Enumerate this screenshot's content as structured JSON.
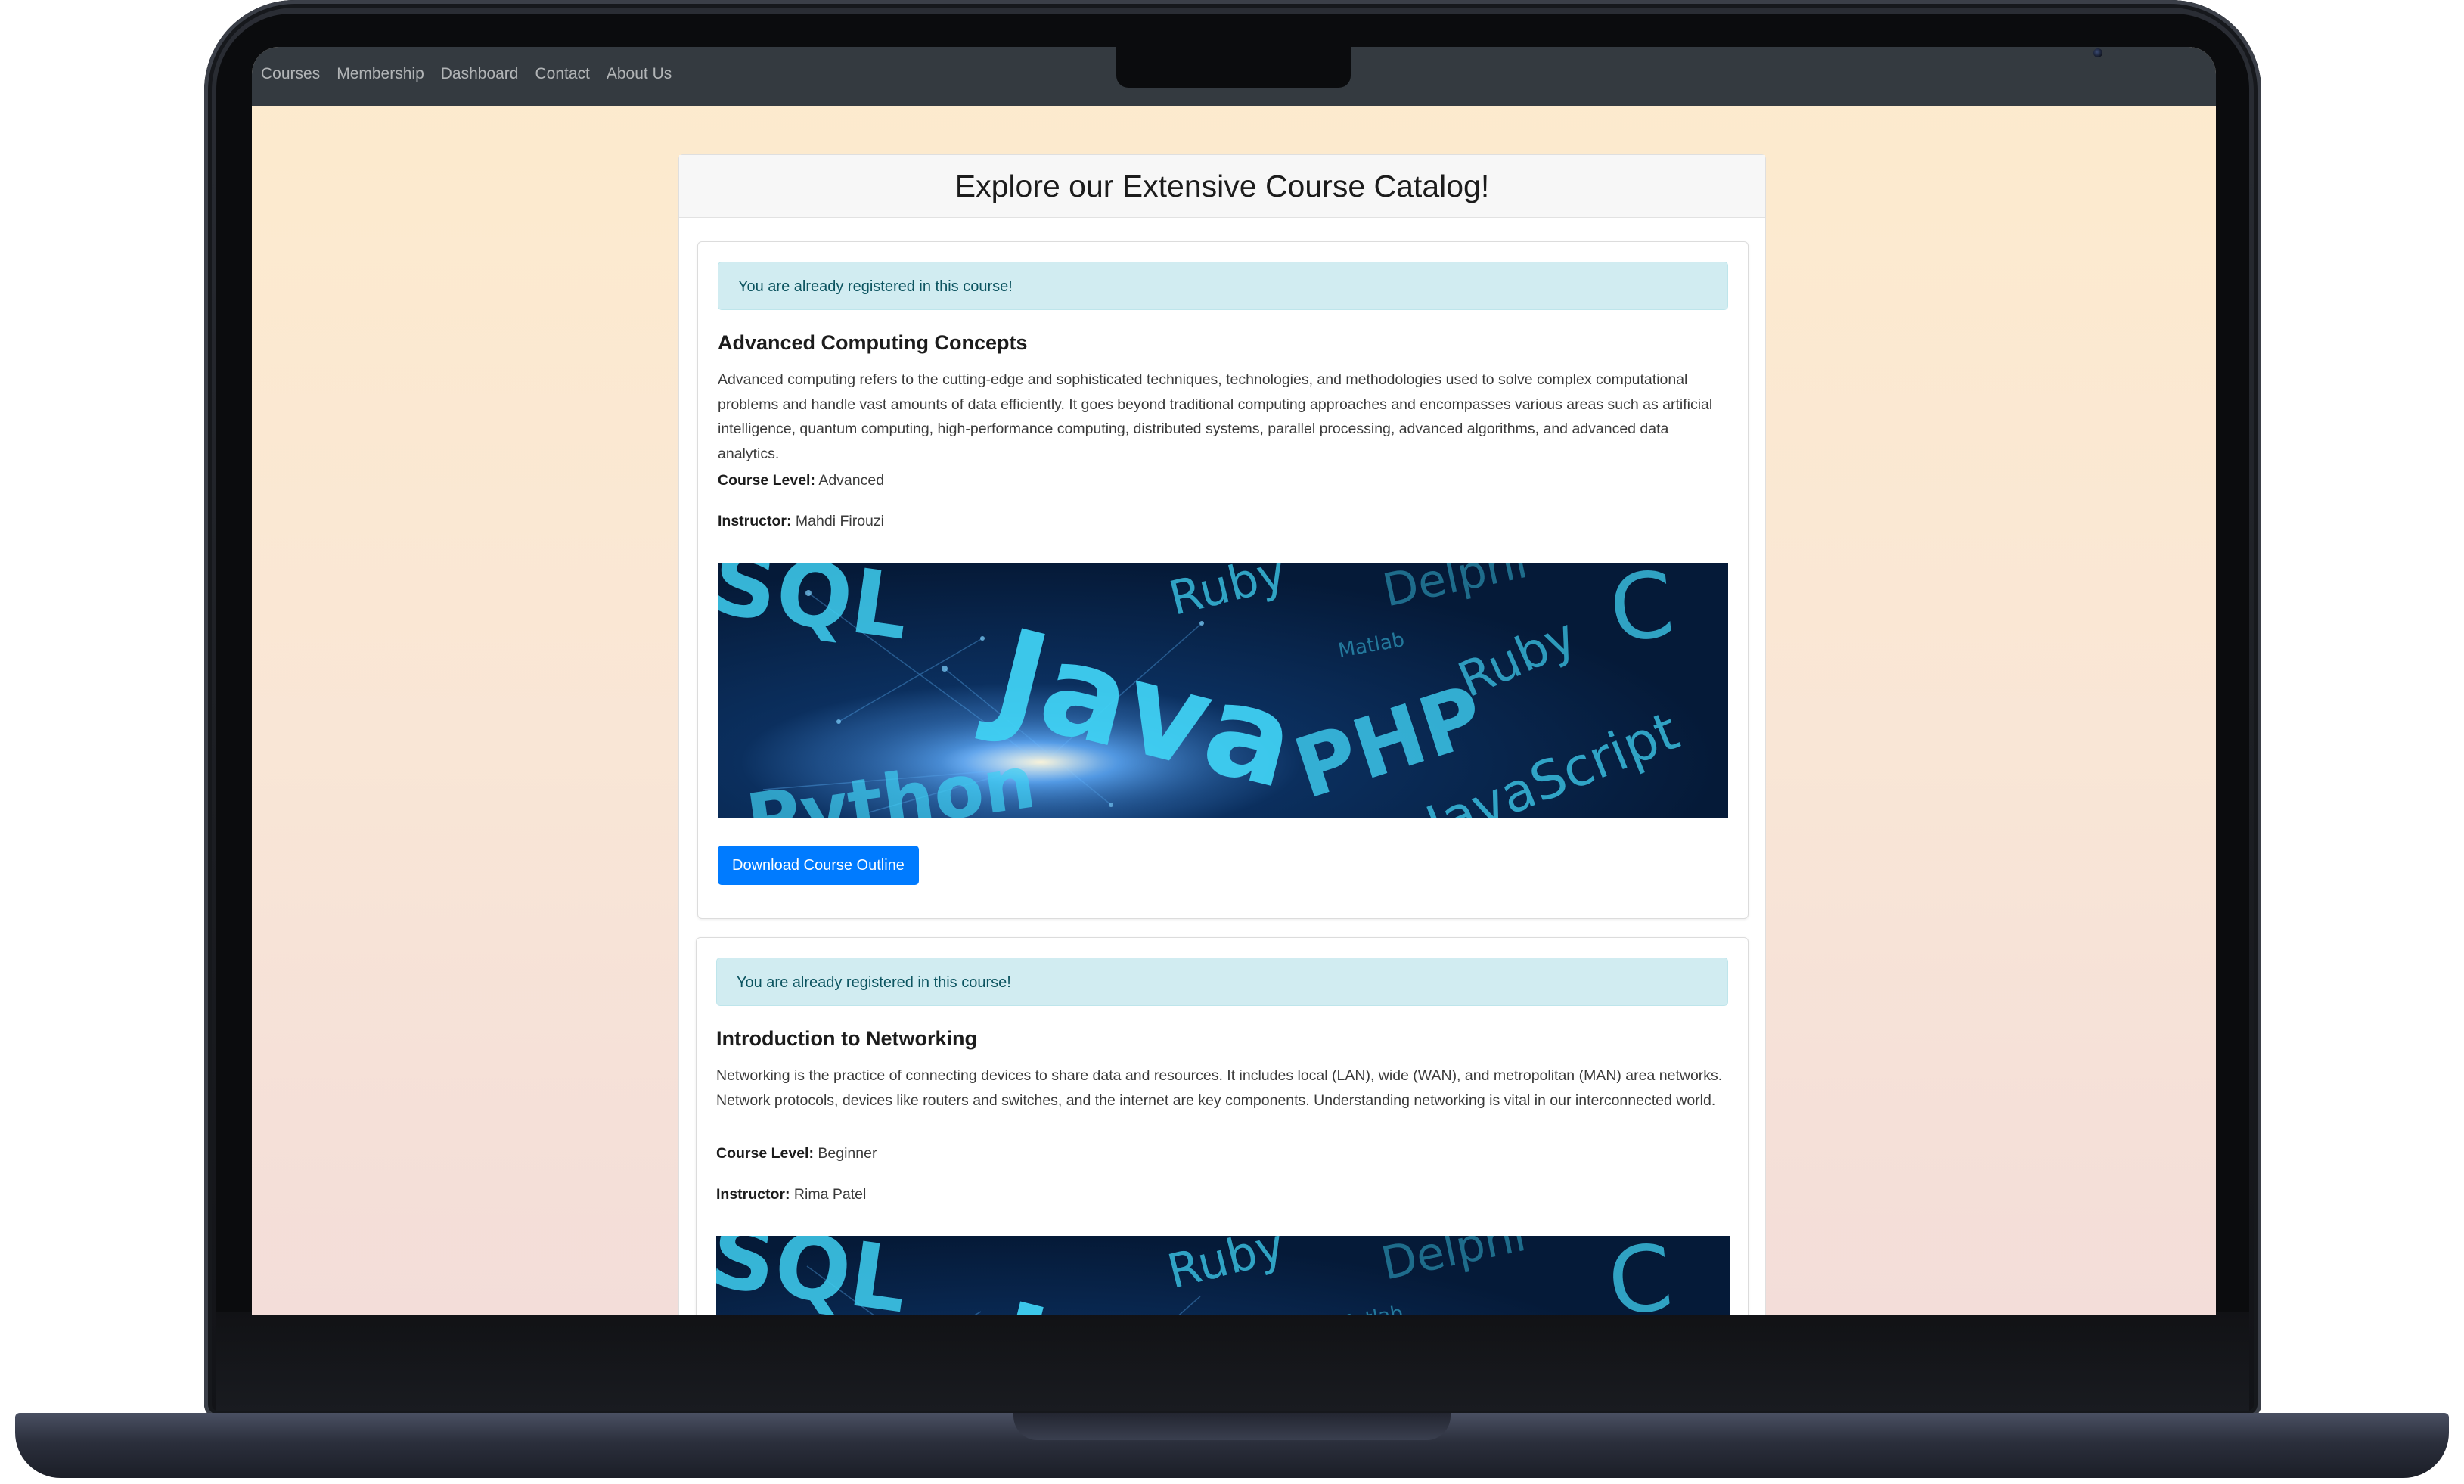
{
  "navbar": {
    "links": [
      "Courses",
      "Membership",
      "Dashboard",
      "Contact",
      "About Us"
    ]
  },
  "catalog": {
    "title": "Explore our Extensive Course Catalog!"
  },
  "courses": [
    {
      "alert": "You are already registered in this course!",
      "title": "Advanced Computing Concepts",
      "description": "Advanced computing refers to the cutting-edge and sophisticated techniques, technologies, and methodologies used to solve complex computational problems and handle vast amounts of data efficiently. It goes beyond traditional computing approaches and encompasses various areas such as artificial intelligence, quantum computing, high-performance computing, distributed systems, parallel processing, advanced algorithms, and advanced data analytics.",
      "level_label": "Course Level:",
      "level": "Advanced",
      "instructor_label": "Instructor:",
      "instructor": "Mahdi Firouzi",
      "download_label": "Download Course Outline"
    },
    {
      "alert": "You are already registered in this course!",
      "title": "Introduction to Networking",
      "description": "Networking is the practice of connecting devices to share data and resources. It includes local (LAN), wide (WAN), and metropolitan (MAN) area networks. Network protocols, devices like routers and switches, and the internet are key components. Understanding networking is vital in our interconnected world.",
      "level_label": "Course Level:",
      "level": "Beginner",
      "instructor_label": "Instructor:",
      "instructor": "Rima Patel"
    }
  ],
  "image_words": [
    "SQL",
    "Ruby",
    "Java",
    "PHP",
    "Ruby",
    "JavaScript",
    "Python",
    "C",
    "Delphi",
    "Matlab"
  ],
  "colors": {
    "navbar": "#343a40",
    "alert_bg": "#d1ecf1",
    "alert_text": "#0c5460",
    "primary_button": "#007bff",
    "image_text": "#3fd0f2"
  },
  "icons": [
    "camera-icon"
  ]
}
